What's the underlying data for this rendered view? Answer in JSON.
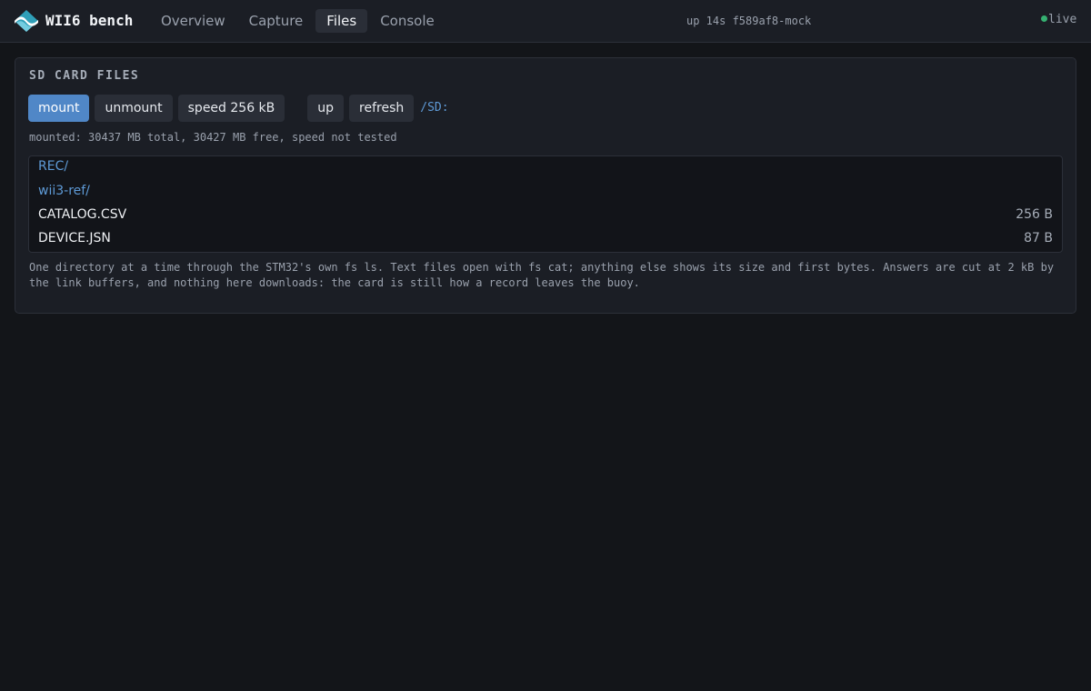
{
  "header": {
    "brand": "WII6 bench",
    "tabs": [
      {
        "label": "Overview"
      },
      {
        "label": "Capture"
      },
      {
        "label": "Files",
        "active": true
      },
      {
        "label": "Console"
      }
    ],
    "status": "up 14s f589af8-mock",
    "live_label": "live"
  },
  "panel": {
    "title": "SD CARD FILES",
    "buttons": {
      "mount": "mount",
      "unmount": "unmount",
      "speed": "speed 256 kB",
      "up": "up",
      "refresh": "refresh"
    },
    "path": "/SD:",
    "mount_info": "mounted: 30437 MB total, 30427 MB free, speed not tested",
    "files": [
      {
        "name": "REC/",
        "type": "dir",
        "size": ""
      },
      {
        "name": "wii3-ref/",
        "type": "dir",
        "size": ""
      },
      {
        "name": "CATALOG.CSV",
        "type": "file",
        "size": "256 B"
      },
      {
        "name": "DEVICE.JSN",
        "type": "file",
        "size": "87 B"
      }
    ],
    "note": "One directory at a time through the STM32's own fs ls. Text files open with fs cat; anything else shows its size and first bytes. Answers are cut at 2 kB by the link buffers, and nothing here downloads: the card is still how a record leaves the buoy."
  },
  "colors": {
    "background": "#131519",
    "surface": "#1b1e25",
    "accent": "#5087c7",
    "link": "#5e9ad6",
    "live": "#35b071"
  },
  "icons": {
    "logo": "wave-logo-icon",
    "live": "status-dot-icon"
  }
}
